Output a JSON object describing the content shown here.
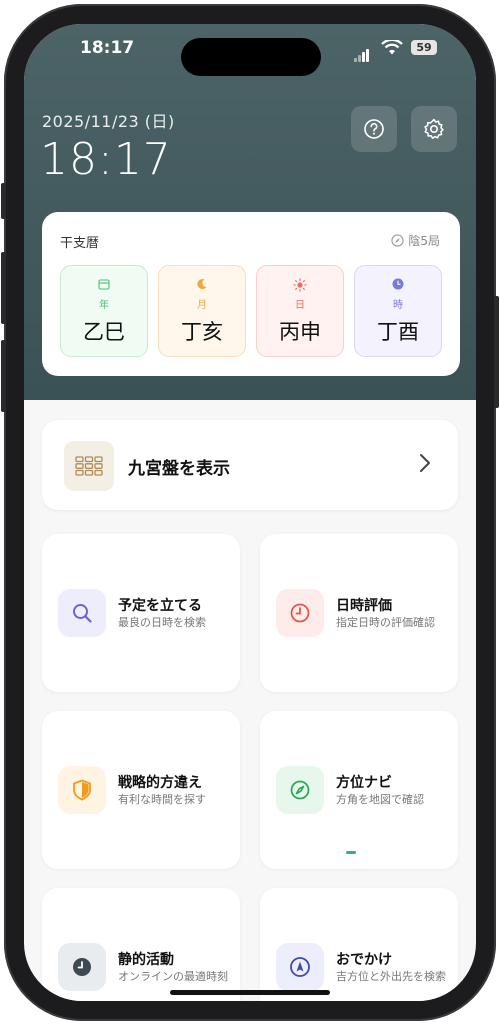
{
  "status_bar": {
    "time": "18:17",
    "battery": "59"
  },
  "header": {
    "date": "2025/11/23 (日)",
    "clock": "18:17"
  },
  "calendar_card": {
    "title": "干支暦",
    "kyoku": "陰5局",
    "pillars": [
      {
        "label": "年",
        "value": "乙巳",
        "accent": "#4cc27a",
        "bg": "#f0fbf3",
        "border": "#c7ebd2"
      },
      {
        "label": "月",
        "value": "丁亥",
        "accent": "#f2a93b",
        "bg": "#fff7ec",
        "border": "#f6dfb9"
      },
      {
        "label": "日",
        "value": "丙申",
        "accent": "#f06b5e",
        "bg": "#fff2f1",
        "border": "#f6cfcb"
      },
      {
        "label": "時",
        "value": "丁酉",
        "accent": "#7b78d8",
        "bg": "#f4f3fd",
        "border": "#d9d7f4"
      }
    ]
  },
  "kyuseiban": {
    "label": "九宮盤を表示"
  },
  "tiles": [
    {
      "title": "予定を立てる",
      "subtitle": "最良の日時を検索",
      "icon": "search-icon"
    },
    {
      "title": "日時評価",
      "subtitle": "指定日時の評価確認",
      "icon": "clock-icon"
    },
    {
      "title": "戦略的方違え",
      "subtitle": "有利な時間を探す",
      "icon": "shield-icon"
    },
    {
      "title": "方位ナビ",
      "subtitle": "方角を地図で確認",
      "icon": "compass-icon"
    },
    {
      "title": "静的活動",
      "subtitle": "オンラインの最適時刻",
      "icon": "clock-icon"
    },
    {
      "title": "おでかけ",
      "subtitle": "吉方位と外出先を検索",
      "icon": "navigation-arrow-icon"
    }
  ]
}
